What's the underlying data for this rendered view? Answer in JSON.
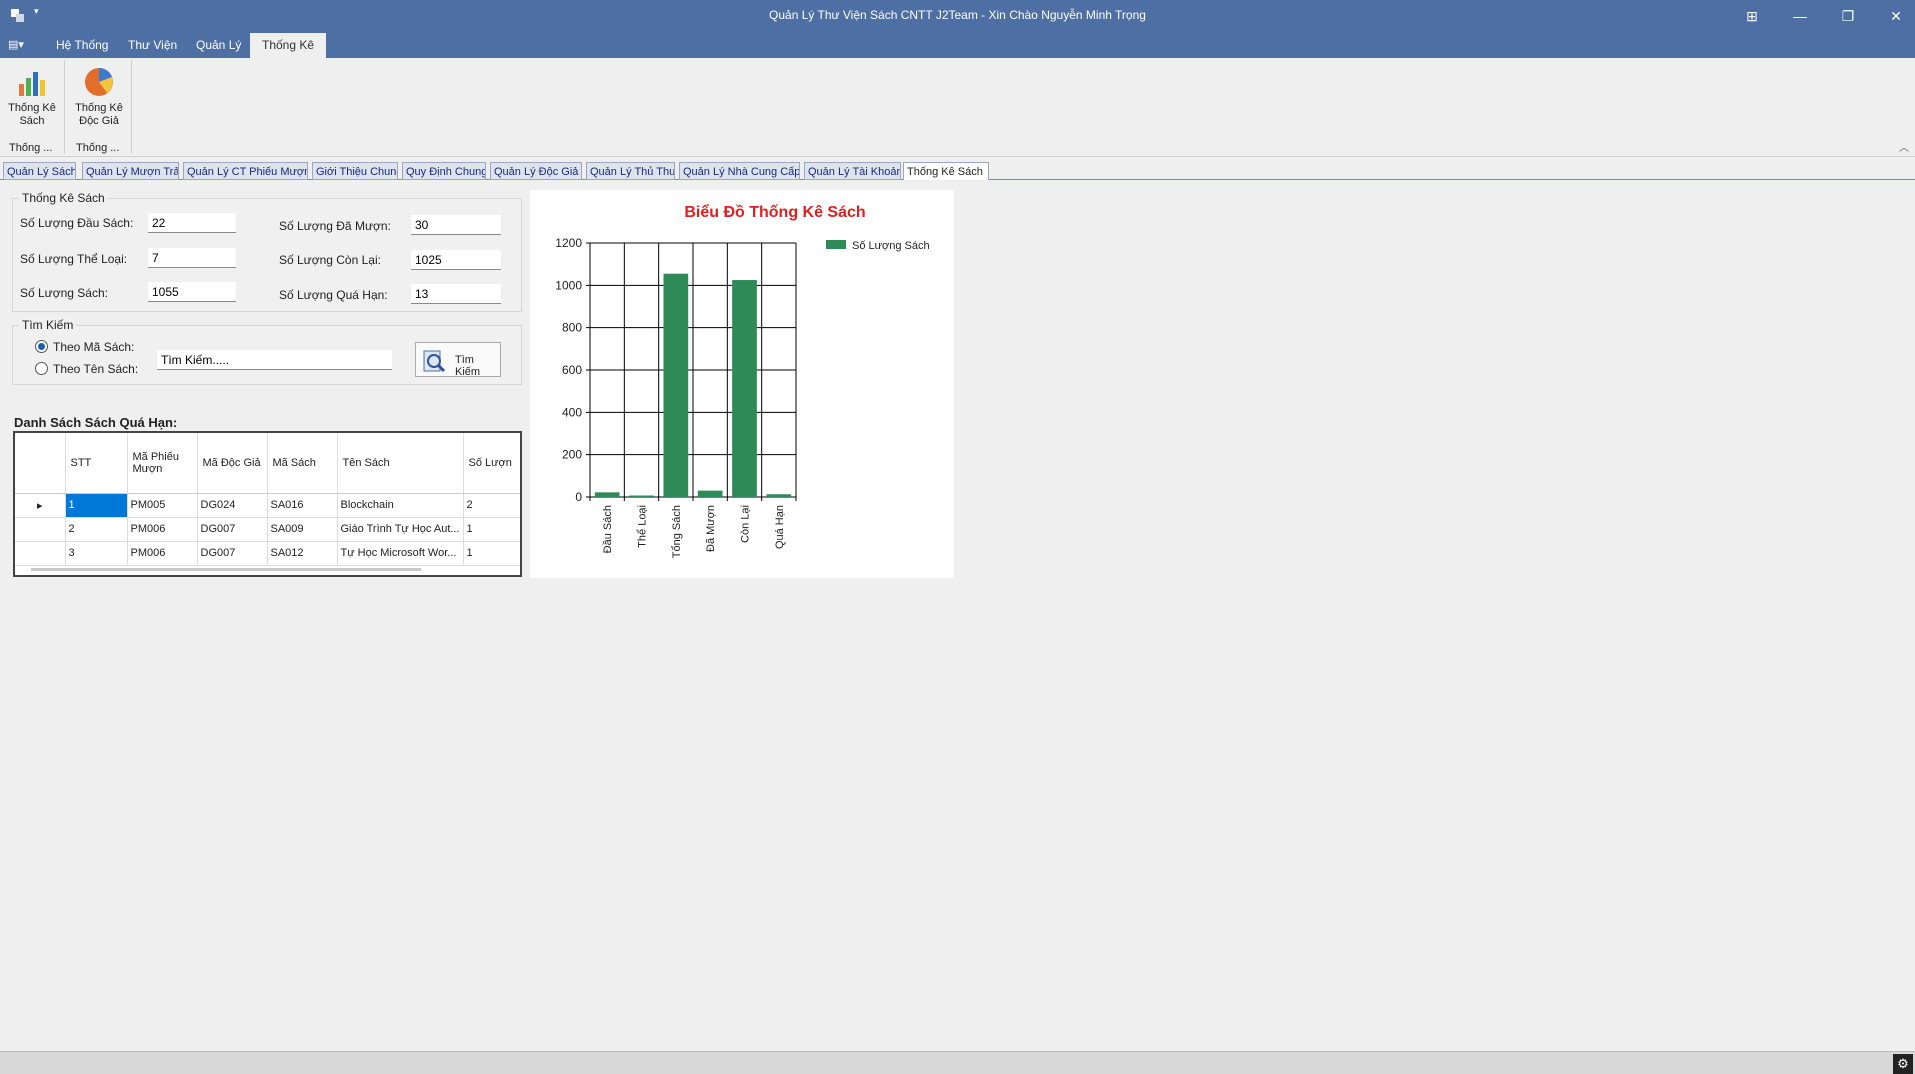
{
  "window": {
    "title": "Quản Lý Thư Viện Sách CNTT J2Team - Xin Chào Nguyễn Minh Trọng",
    "minimize": "—",
    "restore": "❐",
    "close": "✕",
    "extra": "⊞"
  },
  "ribbon": {
    "tabs": [
      {
        "label": "Hệ Thống"
      },
      {
        "label": "Thư Viện"
      },
      {
        "label": "Quản Lý"
      },
      {
        "label": "Thống Kê"
      }
    ],
    "buttons": [
      {
        "label": "Thống Kê Sách",
        "icon": "bar-chart-icon"
      },
      {
        "label": "Thống Kê Độc Giả",
        "icon": "pie-chart-icon"
      }
    ],
    "groups": [
      "Thống ...",
      "Thống ..."
    ]
  },
  "doc_tabs": [
    "Quản Lý Sách",
    "Quản Lý Mượn Trả",
    "Quản Lý CT Phiếu Mượn",
    "Giới Thiệu Chung",
    "Quy Định Chung",
    "Quản Lý Độc Giả",
    "Quản Lý Thủ Thư",
    "Quản Lý Nhà Cung Cấp",
    "Quản Lý Tài Khoản",
    "Thống Kê Sách"
  ],
  "stats": {
    "legend": "Thống Kê Sách",
    "dau_sach_label": "Số Lượng Đầu Sách:",
    "dau_sach_value": "22",
    "the_loai_label": "Số Lượng Thể Loại:",
    "the_loai_value": "7",
    "sach_label": "Số Lượng Sách:",
    "sach_value": "1055",
    "da_muon_label": "Số Lượng Đã Mượn:",
    "da_muon_value": "30",
    "con_lai_label": "Số Lượng Còn Lại:",
    "con_lai_value": "1025",
    "qua_han_label": "Số Lượng Quá Hạn:",
    "qua_han_value": "13"
  },
  "search": {
    "legend": "Tìm Kiếm",
    "option1": "Theo Mã Sách:",
    "option2": "Theo Tên Sách:",
    "input_value": "Tìm Kiếm.....",
    "button_label": "Tìm Kiếm"
  },
  "overdue": {
    "heading": "Danh Sách Sách Quá Hạn:",
    "columns": [
      "STT",
      "Mã Phiếu Mượn",
      "Mã Độc Giả",
      "Mã Sách",
      "Tên Sách",
      "Số Lượn"
    ],
    "rows": [
      [
        "1",
        "PM005",
        "DG024",
        "SA016",
        "Blockchain",
        "2"
      ],
      [
        "2",
        "PM006",
        "DG007",
        "SA009",
        "Giáo Trình Tự Học Aut...",
        "1"
      ],
      [
        "3",
        "PM006",
        "DG007",
        "SA012",
        "Tự Học Microsoft Wor...",
        "1"
      ]
    ]
  },
  "chart_data": {
    "type": "bar",
    "title": "Biểu Đồ Thống Kê Sách",
    "categories": [
      "Đầu Sách",
      "Thể Loại",
      "Tổng Sách",
      "Đã Mượn",
      "Còn Lại",
      "Quá Hạn"
    ],
    "series": [
      {
        "name": "Số Lượng Sách",
        "values": [
          22,
          7,
          1055,
          30,
          1025,
          13
        ]
      }
    ],
    "ylim": [
      0,
      1200
    ],
    "yticks": [
      0,
      200,
      400,
      600,
      800,
      1000,
      1200
    ],
    "grid": true,
    "legend_position": "top-right",
    "color": "#2e8b57"
  }
}
